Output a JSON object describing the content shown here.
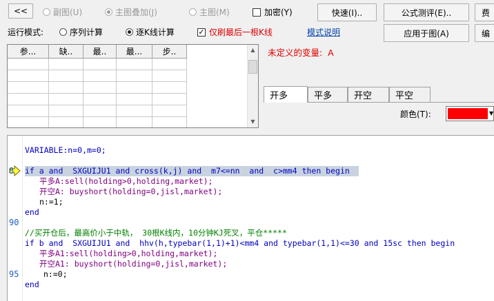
{
  "toolbar": {
    "back_label": "<<",
    "radio_subchart": "副图(U)",
    "radio_overlay": "主图叠加(J)",
    "radio_main": "主图(M)",
    "encrypt_label": "加密(Y)",
    "quick_button": "快速(I)..",
    "formula_test_button": "公式测评(E)..",
    "fee_button": "费",
    "apply_button": "应用于图(A)",
    "edit_button": "编"
  },
  "run_mode": {
    "label": "运行模式:",
    "option_sequence": "序列计算",
    "option_per_bar": "逐K线计算",
    "refresh_last_label": "仅刷最后一根K线",
    "mode_help_link": "模式说明"
  },
  "param_table": {
    "headers": [
      "参...",
      "缺..",
      "最..",
      "最...",
      "步.."
    ]
  },
  "error_message": "未定义的变量:  A",
  "tabs": [
    "开多",
    "平多",
    "开空",
    "平空"
  ],
  "color": {
    "label": "颜色(T):",
    "value": "#ff0000"
  },
  "code": {
    "line1": "VARIABLE:n=0,m=0;",
    "line_if": "if a and  SXGUIJU1 and cross(k,j) and  m7<=nn  and  c>mm4 then begin",
    "line_pd": "平多A:sell(holding>0,holding,market);",
    "line_kk": "开空A: buyshort(holding=0,jisl,market);",
    "line_n": "n:=1;",
    "line_end1": "end",
    "line_comment": "//买开仓后，最高价小于中轨， 30根K线内，10分钟KJ死叉，平仓*****",
    "line_if2": "if b and  SXGUIJU1 and  hhv(h,typebar(1,1)+1)<mm4 and typebar(1,1)<=30 and 15sc then begin",
    "line_pd1": "平多A1:sell(holding>0,holding,market);",
    "line_kk1": "开空A1: buyshort(holding=0,jisl,market);",
    "line_n0": "n:=0;",
    "line_end2": "end",
    "line_numbers": {
      "l8": "8",
      "l90": "90",
      "l95": "95"
    }
  }
}
